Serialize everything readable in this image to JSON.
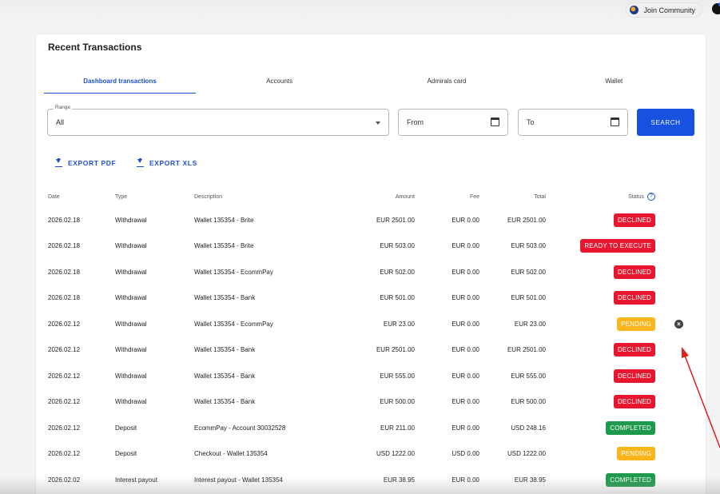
{
  "header": {
    "join_community": "Join Community"
  },
  "page": {
    "title": "Recent Transactions"
  },
  "tabs": [
    "Dashboard transactions",
    "Accounts",
    "Admirals card",
    "Wallet"
  ],
  "filters": {
    "range_label": "Range",
    "range_value": "All",
    "from_placeholder": "From",
    "to_placeholder": "To",
    "search_label": "SEARCH"
  },
  "export": {
    "pdf": "EXPORT PDF",
    "xls": "EXPORT XLS"
  },
  "columns": {
    "date": "Date",
    "type": "Type",
    "description": "Description",
    "amount": "Amount",
    "fee": "Fee",
    "total": "Total",
    "status": "Status"
  },
  "rows": [
    {
      "date": "2026.02.18",
      "type": "Withdrawal",
      "description": "Wallet 135354 - Brite",
      "amount": "EUR 2501.00",
      "fee": "EUR 0.00",
      "total": "EUR 2501.00",
      "status": "DECLINED",
      "status_kind": "declined",
      "cancel": false
    },
    {
      "date": "2026.02.18",
      "type": "Withdrawal",
      "description": "Wallet 135354 - Brite",
      "amount": "EUR 503.00",
      "fee": "EUR 0.00",
      "total": "EUR 503.00",
      "status": "READY TO EXECUTE",
      "status_kind": "ready",
      "cancel": false
    },
    {
      "date": "2026.02.18",
      "type": "Withdrawal",
      "description": "Wallet 135354 - EcommPay",
      "amount": "EUR 502.00",
      "fee": "EUR 0.00",
      "total": "EUR 502.00",
      "status": "DECLINED",
      "status_kind": "declined",
      "cancel": false
    },
    {
      "date": "2026.02.18",
      "type": "Withdrawal",
      "description": "Wallet 135354 - Bank",
      "amount": "EUR 501.00",
      "fee": "EUR 0.00",
      "total": "EUR 501.00",
      "status": "DECLINED",
      "status_kind": "declined",
      "cancel": false
    },
    {
      "date": "2026.02.12",
      "type": "Withdrawal",
      "description": "Wallet 135354 - EcommPay",
      "amount": "EUR 23.00",
      "fee": "EUR 0.00",
      "total": "EUR 23.00",
      "status": "PENDING",
      "status_kind": "pending",
      "cancel": true
    },
    {
      "date": "2026.02.12",
      "type": "Withdrawal",
      "description": "Wallet 135354 - Bank",
      "amount": "EUR 2501.00",
      "fee": "EUR 0.00",
      "total": "EUR 2501.00",
      "status": "DECLINED",
      "status_kind": "declined",
      "cancel": false
    },
    {
      "date": "2026.02.12",
      "type": "Withdrawal",
      "description": "Wallet 135354 - Bank",
      "amount": "EUR 555.00",
      "fee": "EUR 0.00",
      "total": "EUR 555.00",
      "status": "DECLINED",
      "status_kind": "declined",
      "cancel": false
    },
    {
      "date": "2026.02.12",
      "type": "Withdrawal",
      "description": "Wallet 135354 - Bank",
      "amount": "EUR 500.00",
      "fee": "EUR 0.00",
      "total": "EUR 500.00",
      "status": "DECLINED",
      "status_kind": "declined",
      "cancel": false
    },
    {
      "date": "2026.02.12",
      "type": "Deposit",
      "description": "EcommPay - Account 30032528",
      "amount": "EUR 211.00",
      "fee": "EUR 0.00",
      "total": "USD 248.16",
      "status": "COMPLETED",
      "status_kind": "completed",
      "cancel": false
    },
    {
      "date": "2026.02.12",
      "type": "Deposit",
      "description": "Checkout - Wallet 135354",
      "amount": "USD 1222.00",
      "fee": "USD 0.00",
      "total": "USD 1222.00",
      "status": "PENDING",
      "status_kind": "pending",
      "cancel": false
    },
    {
      "date": "2026.02.02",
      "type": "Interest payout",
      "description": "Interest payout - Wallet 135354",
      "amount": "EUR 38.95",
      "fee": "EUR 0.00",
      "total": "EUR 38.95",
      "status": "COMPLETED",
      "status_kind": "completed",
      "cancel": false
    }
  ],
  "colors": {
    "accent": "#1751e0",
    "declined": "#e8172f",
    "pending": "#f9b51c",
    "completed": "#1f9a4d",
    "annotation_arrow": "#e0201f"
  },
  "icons": {
    "download": "download-icon",
    "calendar": "calendar-icon",
    "help": "help-icon",
    "cancel": "close-icon",
    "globe": "globe-icon"
  }
}
